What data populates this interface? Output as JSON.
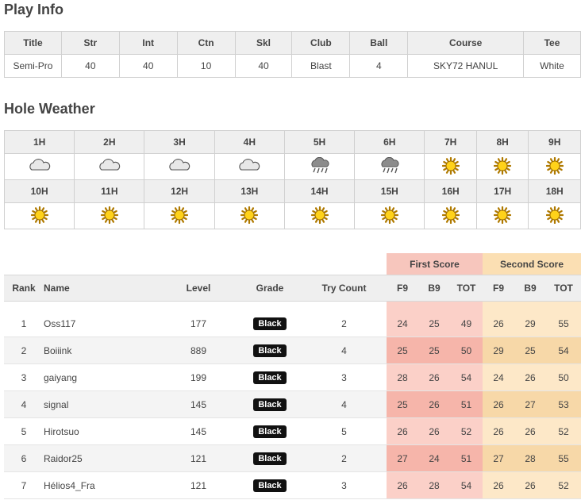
{
  "play_info": {
    "heading": "Play Info",
    "headers": [
      "Title",
      "Str",
      "Int",
      "Ctn",
      "Skl",
      "Club",
      "Ball",
      "Course",
      "Tee"
    ],
    "values": [
      "Semi-Pro",
      "40",
      "40",
      "10",
      "40",
      "Blast",
      "4",
      "SKY72 HANUL",
      "White"
    ]
  },
  "hole_weather": {
    "heading": "Hole Weather",
    "rows": [
      {
        "holes": [
          "1H",
          "2H",
          "3H",
          "4H",
          "5H",
          "6H",
          "7H",
          "8H",
          "9H"
        ],
        "icons": [
          "cloudy-icon",
          "cloudy-icon",
          "cloudy-icon",
          "cloudy-icon",
          "rain-icon",
          "rain-icon",
          "sunny-icon",
          "sunny-icon",
          "sunny-icon"
        ]
      },
      {
        "holes": [
          "10H",
          "11H",
          "12H",
          "13H",
          "14H",
          "15H",
          "16H",
          "17H",
          "18H"
        ],
        "icons": [
          "sunny-icon",
          "sunny-icon",
          "sunny-icon",
          "sunny-icon",
          "sunny-icon",
          "sunny-icon",
          "sunny-icon",
          "sunny-icon",
          "sunny-icon"
        ]
      }
    ]
  },
  "ranking": {
    "group_headers": {
      "first": "First Score",
      "second": "Second Score"
    },
    "headers": {
      "rank": "Rank",
      "name": "Name",
      "level": "Level",
      "grade": "Grade",
      "try_count": "Try Count",
      "f9": "F9",
      "b9": "B9",
      "tot": "TOT"
    },
    "rows": [
      {
        "rank": "1",
        "name": "Oss117",
        "level": "177",
        "grade": "Black",
        "try": "2",
        "first": [
          "24",
          "25",
          "49"
        ],
        "second": [
          "26",
          "29",
          "55"
        ]
      },
      {
        "rank": "2",
        "name": "Boiiink",
        "level": "889",
        "grade": "Black",
        "try": "4",
        "first": [
          "25",
          "25",
          "50"
        ],
        "second": [
          "29",
          "25",
          "54"
        ]
      },
      {
        "rank": "3",
        "name": "gaiyang",
        "level": "199",
        "grade": "Black",
        "try": "3",
        "first": [
          "28",
          "26",
          "54"
        ],
        "second": [
          "24",
          "26",
          "50"
        ]
      },
      {
        "rank": "4",
        "name": "signal",
        "level": "145",
        "grade": "Black",
        "try": "4",
        "first": [
          "25",
          "26",
          "51"
        ],
        "second": [
          "26",
          "27",
          "53"
        ]
      },
      {
        "rank": "5",
        "name": "Hirotsuo",
        "level": "145",
        "grade": "Black",
        "try": "5",
        "first": [
          "26",
          "26",
          "52"
        ],
        "second": [
          "26",
          "26",
          "52"
        ]
      },
      {
        "rank": "6",
        "name": "Raidor25",
        "level": "121",
        "grade": "Black",
        "try": "2",
        "first": [
          "27",
          "24",
          "51"
        ],
        "second": [
          "27",
          "28",
          "55"
        ]
      },
      {
        "rank": "7",
        "name": "Hélios4_Fra",
        "level": "121",
        "grade": "Black",
        "try": "3",
        "first": [
          "26",
          "28",
          "54"
        ],
        "second": [
          "26",
          "26",
          "52"
        ]
      }
    ]
  }
}
